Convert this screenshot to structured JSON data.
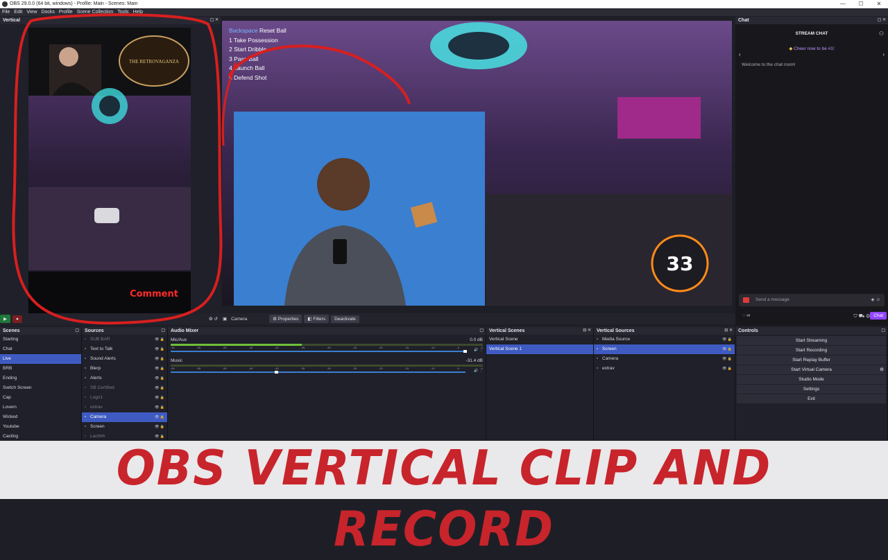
{
  "window": {
    "title": "OBS 29.0.0 (64 bit, windows) - Profile: Main - Scenes: Main"
  },
  "menu": [
    "File",
    "Edit",
    "View",
    "Docks",
    "Profile",
    "Scene Collection",
    "Tools",
    "Help"
  ],
  "vertical_dock": {
    "title": "Vertical",
    "logo_text": "THE RETROVAGANZA",
    "comment_text": "Comment"
  },
  "main_preview": {
    "hotkeys": [
      {
        "key": "Backspace",
        "label": "Reset Ball"
      },
      {
        "key": "1",
        "label": "Take Possession"
      },
      {
        "key": "2",
        "label": "Start Dribble"
      },
      {
        "key": "3",
        "label": "Pass Ball"
      },
      {
        "key": "4",
        "label": "Launch Ball"
      },
      {
        "key": "5",
        "label": "Defend Shot"
      }
    ],
    "boost_value": "33"
  },
  "source_bar": {
    "source": "Camera",
    "properties": "Properties",
    "filters": "Filters",
    "deactivate": "Deactivate"
  },
  "chat": {
    "dock_title": "Chat",
    "header": "STREAM CHAT",
    "cheer": "Cheer now to be #1!",
    "welcome": "Welcome to the chat room!",
    "send_placeholder": "Send a message",
    "points": "∞",
    "chat_button": "Chat"
  },
  "scenes": {
    "title": "Scenes",
    "items": [
      "Starting",
      "Chat",
      "Live",
      "BRB",
      "Ending",
      "Switch Screen",
      "Cap",
      "Lovern",
      "Wicked",
      "Youtube",
      "Casting"
    ],
    "selected": 2
  },
  "sources": {
    "title": "Sources",
    "items": [
      {
        "label": "SUB BAR",
        "dim": true
      },
      {
        "label": "Text to Talk",
        "dim": false
      },
      {
        "label": "Sound Alerts",
        "dim": false
      },
      {
        "label": "Blerp",
        "dim": false
      },
      {
        "label": "Alerts",
        "dim": false
      },
      {
        "label": "SB Certified",
        "dim": true
      },
      {
        "label": "Logo1",
        "dim": true
      },
      {
        "label": "extrav",
        "dim": true
      },
      {
        "label": "Camera",
        "dim": false,
        "sel": true
      },
      {
        "label": "Screen",
        "dim": false
      },
      {
        "label": "Lachhh",
        "dim": true
      }
    ]
  },
  "audio_mixer": {
    "title": "Audio Mixer",
    "channels": [
      {
        "name": "Mic/Aux",
        "db": "0.0 dB",
        "level": 0.42
      },
      {
        "name": "Music",
        "db": "-31.4 dB",
        "level": 0.0
      }
    ],
    "ticks": [
      "-60",
      "-55",
      "-50",
      "-45",
      "-40",
      "-35",
      "-30",
      "-25",
      "-20",
      "-15",
      "-10",
      "-5",
      "0"
    ]
  },
  "vertical_scenes": {
    "title": "Vertical Scenes",
    "items": [
      "Vertical Scene",
      "Vertical Scene 1"
    ],
    "selected": 1
  },
  "vertical_sources": {
    "title": "Vertical Sources",
    "items": [
      "Media Source",
      "Screen",
      "Camera",
      "extrav"
    ],
    "selected": 1
  },
  "controls": {
    "title": "Controls",
    "items": [
      "Start Streaming",
      "Start Recording",
      "Start Replay Buffer",
      "Start Virtual Camera",
      "Studio Mode",
      "Settings",
      "Exit"
    ]
  },
  "banner": {
    "text": "OBS VERTICAL CLIP AND RECORD"
  },
  "colors": {
    "annotation_red": "#d81f1f",
    "selection_blue": "#3f5bc2",
    "chat_purple": "#9147ff",
    "banner_red": "#c8242b"
  }
}
